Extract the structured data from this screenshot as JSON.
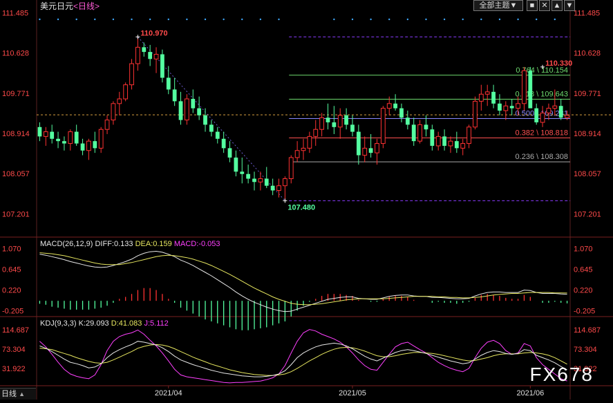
{
  "header": {
    "instrument": "美元日元",
    "period_open": "<",
    "period": "日线",
    "period_close": ">",
    "theme_button": "全部主题▼",
    "window_controls": [
      "■",
      "✕",
      "▲",
      "▼"
    ]
  },
  "watermark": "FX678",
  "bottom_tab": "日线",
  "bottom_arrow": "▲",
  "colors": {
    "up": "#ff3232",
    "down": "#54ffa0",
    "white": "#e8e8e8",
    "yellow": "#e8e860",
    "magenta": "#ff40ff",
    "purple": "#8a3bff",
    "fib_green": "#6fdc6f",
    "fib_blue": "#8a8aff",
    "fib_red": "#ff5050",
    "fib_gray": "#aaaaaa"
  },
  "chart_data": [
    {
      "type": "candlestick",
      "name": "price",
      "y_ticks": [
        "111.485",
        "110.628",
        "109.771",
        "108.914",
        "108.057",
        "107.201"
      ],
      "ylim": [
        106.75,
        111.55
      ],
      "x_ticks": [
        {
          "label": "2021/04",
          "index": 21
        },
        {
          "label": "2021/05",
          "index": 51
        },
        {
          "label": "2021/06",
          "index": 80
        }
      ],
      "annotations": [
        {
          "text": "110.970",
          "index": 16,
          "value": 110.97
        },
        {
          "text": "110.330",
          "index": 82,
          "value": 110.33
        },
        {
          "text": "107.480",
          "index": 40,
          "value": 107.48
        }
      ],
      "last_price": 109.31,
      "fib_levels": [
        {
          "label": "0.764 \\ 110.154",
          "value": 110.154,
          "color": "#6fdc6f"
        },
        {
          "label": "0.618 \\ 109.643",
          "value": 109.643,
          "color": "#6fdc6f"
        },
        {
          "label": "0.500 \\ 109.231",
          "value": 109.231,
          "color": "#8a8aff"
        },
        {
          "label": "0.382 \\ 108.818",
          "value": 108.818,
          "color": "#ff5050"
        },
        {
          "label": "0.236 \\ 108.308",
          "value": 108.308,
          "color": "#aaaaaa"
        }
      ],
      "fib_extremes": [
        110.97,
        107.48
      ],
      "candles": [
        [
          109.05,
          109.15,
          108.75,
          108.85
        ],
        [
          108.85,
          109.05,
          108.65,
          108.95
        ],
        [
          108.95,
          109.1,
          108.7,
          108.8
        ],
        [
          108.8,
          108.95,
          108.6,
          108.75
        ],
        [
          108.75,
          108.85,
          108.55,
          108.7
        ],
        [
          108.7,
          109.0,
          108.55,
          108.95
        ],
        [
          108.95,
          109.1,
          108.65,
          108.7
        ],
        [
          108.7,
          108.8,
          108.45,
          108.55
        ],
        [
          108.55,
          108.8,
          108.35,
          108.75
        ],
        [
          108.75,
          108.95,
          108.5,
          108.6
        ],
        [
          108.6,
          109.05,
          108.5,
          109.0
        ],
        [
          109.0,
          109.3,
          108.9,
          109.2
        ],
        [
          109.2,
          109.6,
          109.1,
          109.55
        ],
        [
          109.55,
          109.8,
          109.3,
          109.65
        ],
        [
          109.65,
          110.0,
          109.6,
          109.95
        ],
        [
          109.95,
          110.5,
          109.85,
          110.4
        ],
        [
          110.4,
          110.97,
          110.25,
          110.75
        ],
        [
          110.75,
          110.85,
          110.55,
          110.65
        ],
        [
          110.65,
          110.8,
          110.35,
          110.5
        ],
        [
          110.5,
          110.75,
          110.2,
          110.6
        ],
        [
          110.6,
          110.7,
          110.0,
          110.1
        ],
        [
          110.1,
          110.35,
          109.75,
          109.85
        ],
        [
          109.85,
          110.1,
          109.5,
          109.6
        ],
        [
          109.6,
          109.8,
          109.1,
          109.2
        ],
        [
          109.2,
          109.75,
          109.1,
          109.65
        ],
        [
          109.65,
          109.85,
          109.35,
          109.45
        ],
        [
          109.45,
          109.7,
          109.2,
          109.3
        ],
        [
          109.3,
          109.45,
          108.95,
          109.1
        ],
        [
          109.1,
          109.2,
          108.85,
          108.95
        ],
        [
          108.95,
          109.05,
          108.7,
          108.8
        ],
        [
          108.8,
          108.95,
          108.5,
          108.6
        ],
        [
          108.6,
          108.75,
          108.3,
          108.4
        ],
        [
          108.4,
          108.55,
          108.0,
          108.1
        ],
        [
          108.1,
          108.4,
          107.85,
          108.05
        ],
        [
          108.05,
          108.25,
          107.85,
          107.95
        ],
        [
          107.95,
          108.1,
          107.7,
          107.88
        ],
        [
          107.88,
          108.1,
          107.7,
          107.95
        ],
        [
          107.95,
          108.2,
          107.75,
          107.8
        ],
        [
          107.8,
          107.95,
          107.6,
          107.7
        ],
        [
          107.7,
          107.95,
          107.55,
          107.8
        ],
        [
          107.8,
          108.0,
          107.48,
          107.95
        ],
        [
          107.95,
          108.45,
          107.85,
          108.4
        ],
        [
          108.4,
          108.75,
          108.3,
          108.55
        ],
        [
          108.55,
          108.8,
          108.35,
          108.6
        ],
        [
          108.6,
          108.95,
          108.5,
          108.85
        ],
        [
          108.85,
          109.2,
          108.65,
          109.0
        ],
        [
          109.0,
          109.35,
          108.85,
          109.25
        ],
        [
          109.25,
          109.55,
          109.0,
          109.15
        ],
        [
          109.15,
          109.5,
          108.9,
          109.05
        ],
        [
          109.05,
          109.45,
          108.8,
          109.3
        ],
        [
          109.3,
          109.45,
          109.0,
          109.1
        ],
        [
          109.1,
          109.3,
          108.85,
          108.95
        ],
        [
          108.95,
          109.1,
          108.25,
          108.45
        ],
        [
          108.45,
          108.85,
          108.3,
          108.6
        ],
        [
          108.6,
          108.9,
          108.4,
          108.5
        ],
        [
          108.5,
          108.8,
          108.25,
          108.7
        ],
        [
          108.7,
          109.5,
          108.6,
          109.45
        ],
        [
          109.45,
          109.7,
          109.3,
          109.55
        ],
        [
          109.55,
          109.75,
          109.4,
          109.45
        ],
        [
          109.45,
          109.55,
          109.15,
          109.25
        ],
        [
          109.25,
          109.4,
          109.0,
          109.1
        ],
        [
          109.1,
          109.25,
          108.65,
          108.75
        ],
        [
          108.75,
          109.2,
          108.7,
          109.1
        ],
        [
          109.1,
          109.3,
          108.85,
          109.0
        ],
        [
          109.0,
          109.1,
          108.55,
          108.65
        ],
        [
          108.65,
          108.95,
          108.55,
          108.85
        ],
        [
          108.85,
          109.0,
          108.55,
          108.65
        ],
        [
          108.65,
          108.85,
          108.5,
          108.75
        ],
        [
          108.75,
          108.95,
          108.5,
          108.6
        ],
        [
          108.6,
          108.8,
          108.45,
          108.7
        ],
        [
          108.7,
          109.1,
          108.6,
          109.05
        ],
        [
          109.05,
          109.7,
          109.0,
          109.6
        ],
        [
          109.6,
          109.95,
          109.4,
          109.75
        ],
        [
          109.75,
          109.95,
          109.5,
          109.8
        ],
        [
          109.8,
          109.95,
          109.45,
          109.55
        ],
        [
          109.55,
          109.75,
          109.3,
          109.4
        ],
        [
          109.4,
          109.6,
          109.2,
          109.5
        ],
        [
          109.5,
          109.65,
          109.3,
          109.45
        ],
        [
          109.45,
          109.7,
          109.3,
          109.55
        ],
        [
          109.55,
          110.33,
          109.4,
          110.25
        ],
        [
          110.25,
          110.33,
          109.7,
          109.45
        ],
        [
          109.45,
          109.55,
          109.1,
          109.15
        ],
        [
          109.15,
          109.5,
          109.05,
          109.35
        ],
        [
          109.35,
          109.55,
          109.2,
          109.45
        ],
        [
          109.45,
          109.85,
          109.3,
          109.5
        ],
        [
          109.5,
          109.65,
          109.2,
          109.25
        ],
        [
          109.25,
          109.4,
          109.2,
          109.3
        ]
      ],
      "x_count": 87
    },
    {
      "type": "line",
      "name": "MACD",
      "title": "MACD(26,12,9)",
      "readouts": [
        {
          "label": "DIFF:0.133",
          "color": "#e8e8e8"
        },
        {
          "label": "DEA:0.159",
          "color": "#e8e860"
        },
        {
          "label": "MACD:-0.053",
          "color": "#ff40ff"
        }
      ],
      "y_ticks": [
        "1.070",
        "0.645",
        "0.220",
        "-0.205"
      ],
      "ylim": [
        -0.35,
        1.13
      ],
      "diff": [
        0.95,
        0.93,
        0.9,
        0.87,
        0.84,
        0.8,
        0.77,
        0.74,
        0.71,
        0.69,
        0.68,
        0.69,
        0.72,
        0.76,
        0.8,
        0.85,
        0.92,
        0.97,
        1.0,
        1.01,
        0.99,
        0.95,
        0.9,
        0.83,
        0.78,
        0.72,
        0.65,
        0.58,
        0.51,
        0.43,
        0.35,
        0.27,
        0.18,
        0.1,
        0.03,
        -0.03,
        -0.08,
        -0.13,
        -0.17,
        -0.2,
        -0.22,
        -0.21,
        -0.17,
        -0.13,
        -0.09,
        -0.05,
        -0.01,
        0.03,
        0.05,
        0.07,
        0.08,
        0.08,
        0.05,
        0.04,
        0.03,
        0.03,
        0.06,
        0.09,
        0.11,
        0.12,
        0.12,
        0.1,
        0.09,
        0.09,
        0.07,
        0.07,
        0.06,
        0.05,
        0.04,
        0.04,
        0.05,
        0.1,
        0.14,
        0.17,
        0.18,
        0.18,
        0.17,
        0.17,
        0.17,
        0.22,
        0.21,
        0.17,
        0.15,
        0.15,
        0.15,
        0.14,
        0.133
      ],
      "dea": [
        0.98,
        0.97,
        0.96,
        0.94,
        0.92,
        0.89,
        0.86,
        0.83,
        0.8,
        0.77,
        0.75,
        0.74,
        0.74,
        0.74,
        0.76,
        0.78,
        0.81,
        0.84,
        0.87,
        0.9,
        0.92,
        0.93,
        0.92,
        0.9,
        0.88,
        0.85,
        0.81,
        0.77,
        0.72,
        0.66,
        0.6,
        0.54,
        0.47,
        0.4,
        0.33,
        0.26,
        0.2,
        0.14,
        0.08,
        0.03,
        -0.01,
        -0.05,
        -0.07,
        -0.08,
        -0.08,
        -0.07,
        -0.06,
        -0.04,
        -0.02,
        0.0,
        0.02,
        0.03,
        0.04,
        0.04,
        0.04,
        0.04,
        0.04,
        0.05,
        0.06,
        0.07,
        0.08,
        0.09,
        0.09,
        0.09,
        0.09,
        0.08,
        0.08,
        0.07,
        0.07,
        0.06,
        0.06,
        0.07,
        0.08,
        0.1,
        0.12,
        0.13,
        0.14,
        0.15,
        0.15,
        0.16,
        0.17,
        0.17,
        0.17,
        0.17,
        0.16,
        0.16,
        0.159
      ]
    },
    {
      "type": "line",
      "name": "KDJ",
      "title": "KDJ(9,3,3)",
      "readouts": [
        {
          "label": "K:29.093",
          "color": "#e8e8e8"
        },
        {
          "label": "D:41.083",
          "color": "#e8e860"
        },
        {
          "label": "J:5.112",
          "color": "#ff40ff"
        }
      ],
      "y_ticks": [
        "114.687",
        "73.304",
        "31.922"
      ],
      "ylim": [
        -8,
        122
      ],
      "k": [
        80,
        75,
        68,
        60,
        52,
        45,
        42,
        38,
        33,
        35,
        42,
        55,
        65,
        72,
        78,
        83,
        90,
        88,
        85,
        82,
        76,
        68,
        58,
        50,
        45,
        40,
        36,
        32,
        28,
        25,
        22,
        20,
        18,
        16,
        15,
        14,
        14,
        15,
        17,
        20,
        27,
        40,
        55,
        65,
        72,
        78,
        82,
        84,
        86,
        84,
        80,
        74,
        66,
        58,
        52,
        48,
        54,
        60,
        66,
        70,
        72,
        70,
        67,
        64,
        60,
        56,
        52,
        48,
        45,
        42,
        44,
        52,
        60,
        66,
        70,
        68,
        64,
        62,
        64,
        72,
        70,
        60,
        55,
        50,
        44,
        36,
        29.093
      ],
      "d": [
        75,
        74,
        72,
        68,
        64,
        60,
        55,
        51,
        47,
        44,
        43,
        45,
        50,
        56,
        62,
        68,
        75,
        79,
        82,
        83,
        82,
        79,
        74,
        68,
        62,
        56,
        51,
        46,
        41,
        37,
        33,
        29,
        26,
        23,
        21,
        19,
        18,
        17,
        17,
        18,
        20,
        25,
        32,
        40,
        48,
        55,
        62,
        68,
        73,
        76,
        77,
        76,
        73,
        69,
        64,
        59,
        57,
        57,
        59,
        62,
        64,
        66,
        66,
        65,
        64,
        62,
        59,
        56,
        53,
        50,
        48,
        49,
        52,
        55,
        59,
        62,
        63,
        63,
        63,
        65,
        66,
        65,
        63,
        60,
        55,
        48,
        41.083
      ],
      "j": [
        90,
        78,
        62,
        45,
        30,
        20,
        15,
        12,
        10,
        18,
        40,
        70,
        90,
        100,
        105,
        108,
        114,
        105,
        92,
        80,
        65,
        48,
        30,
        18,
        14,
        12,
        10,
        8,
        6,
        4,
        2,
        1,
        2,
        2,
        3,
        4,
        5,
        8,
        12,
        20,
        38,
        65,
        90,
        108,
        115,
        112,
        105,
        100,
        95,
        88,
        78,
        65,
        50,
        38,
        30,
        28,
        45,
        62,
        78,
        85,
        88,
        80,
        72,
        65,
        55,
        45,
        38,
        32,
        28,
        25,
        32,
        55,
        75,
        88,
        92,
        85,
        70,
        62,
        65,
        85,
        80,
        55,
        40,
        30,
        20,
        10,
        5.112
      ]
    }
  ]
}
